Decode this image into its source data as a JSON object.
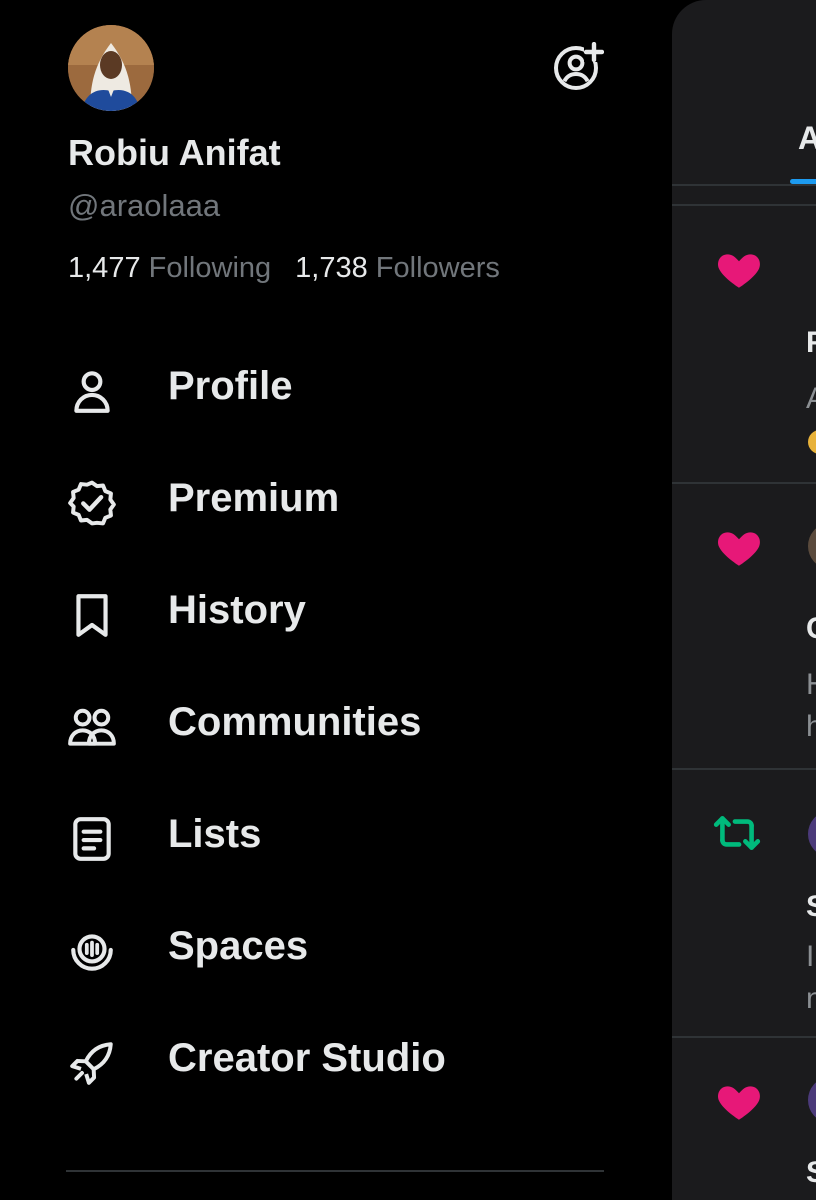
{
  "profile": {
    "display_name": "Robiu Anifat",
    "handle": "@araolaaa",
    "following_count": "1,477",
    "following_label": "Following",
    "followers_count": "1,738",
    "followers_label": "Followers"
  },
  "menu": {
    "items": [
      {
        "label": "Profile",
        "icon": "person-icon"
      },
      {
        "label": "Premium",
        "icon": "verified-badge-icon"
      },
      {
        "label": "History",
        "icon": "bookmark-icon"
      },
      {
        "label": "Communities",
        "icon": "people-icon"
      },
      {
        "label": "Lists",
        "icon": "list-icon"
      },
      {
        "label": "Spaces",
        "icon": "microphone-icon"
      },
      {
        "label": "Creator Studio",
        "icon": "rocket-icon"
      }
    ]
  },
  "background": {
    "tab_fragment": "A",
    "notifications": [
      {
        "icon": "heart-icon",
        "text_fragments": [
          "F",
          "A"
        ]
      },
      {
        "icon": "heart-icon",
        "text_fragments": [
          "C",
          "H",
          "h"
        ]
      },
      {
        "icon": "repost-icon",
        "text_fragments": [
          "S",
          "I",
          "n"
        ]
      },
      {
        "icon": "heart-icon",
        "text_fragments": [
          "S"
        ]
      }
    ]
  },
  "colors": {
    "background": "#000000",
    "text": "#e7e9ea",
    "secondary_text": "#71767b",
    "heart": "#f91880",
    "repost": "#00ba7c",
    "accent": "#1d9bf0"
  }
}
